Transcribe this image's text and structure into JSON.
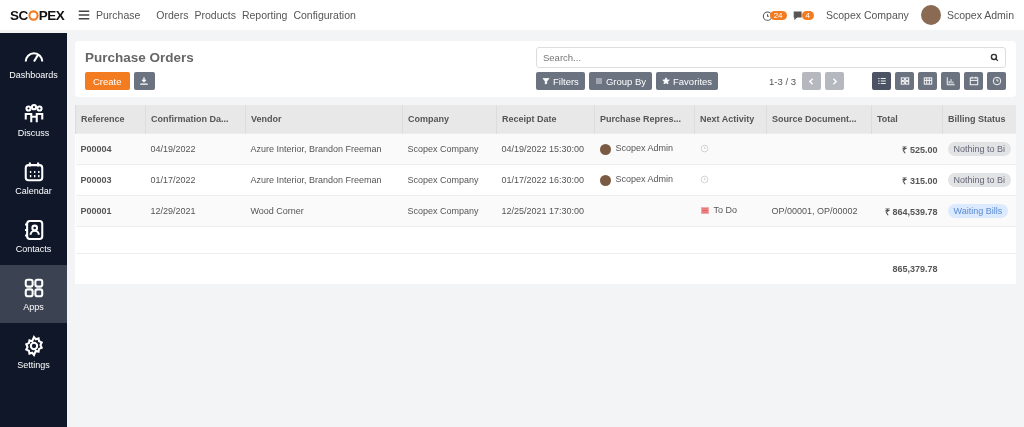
{
  "brand": {
    "left": "SC",
    "right": "PEX"
  },
  "app_menu": "Purchase",
  "menu": [
    "Orders",
    "Products",
    "Reporting",
    "Configuration"
  ],
  "systray": {
    "activity_count": "24",
    "message_count": "4",
    "company": "Scopex Company",
    "user": "Scopex Admin"
  },
  "sidebar": {
    "items": [
      {
        "label": "Dashboards",
        "selected": false
      },
      {
        "label": "Discuss",
        "selected": false
      },
      {
        "label": "Calendar",
        "selected": false
      },
      {
        "label": "Contacts",
        "selected": false
      },
      {
        "label": "Apps",
        "selected": true
      },
      {
        "label": "Settings",
        "selected": false
      }
    ]
  },
  "title": "Purchase Orders",
  "buttons": {
    "create": "Create"
  },
  "search": {
    "placeholder": "Search..."
  },
  "filters": [
    "Filters",
    "Group By",
    "Favorites"
  ],
  "pager": "1-3 / 3",
  "views": [
    {
      "selected": true
    },
    {
      "selected": false
    },
    {
      "selected": false
    },
    {
      "selected": false
    },
    {
      "selected": false
    },
    {
      "selected": false
    }
  ],
  "table": {
    "columns": [
      "Reference",
      "Confirmation Da...",
      "Vendor",
      "Company",
      "Receipt Date",
      "Purchase Repres...",
      "Next Activity",
      "Source Document...",
      "Total",
      "Billing Status"
    ],
    "rows": [
      {
        "reference": "P00004",
        "confirmation": "04/19/2022",
        "vendor": "Azure Interior, Brandon Freeman",
        "company": "Scopex Company",
        "receipt": "04/19/2022 15:30:00",
        "representative": "Scopex Admin",
        "activity": {
          "kind": "clock"
        },
        "source": "",
        "total": "₹ 525.00",
        "billing": {
          "label": "Nothing to Bi",
          "color": "#e2e3e5"
        }
      },
      {
        "reference": "P00003",
        "confirmation": "01/17/2022",
        "vendor": "Azure Interior, Brandon Freeman",
        "company": "Scopex Company",
        "receipt": "01/17/2022 16:30:00",
        "representative": "Scopex Admin",
        "activity": {
          "kind": "clock"
        },
        "source": "",
        "total": "₹ 315.00",
        "billing": {
          "label": "Nothing to Bi",
          "color": "#e2e3e5"
        }
      },
      {
        "reference": "P00001",
        "confirmation": "12/29/2021",
        "vendor": "Wood Corner",
        "company": "Scopex Company",
        "receipt": "12/25/2021 17:30:00",
        "activity": {
          "kind": "todo",
          "label": "To Do"
        },
        "source": "OP/00001, OP/00002",
        "total": "₹ 864,539.78",
        "billing": {
          "label": "Waiting Bills",
          "color": "#dbeafe"
        }
      }
    ],
    "sum_total": "865,379.78"
  }
}
